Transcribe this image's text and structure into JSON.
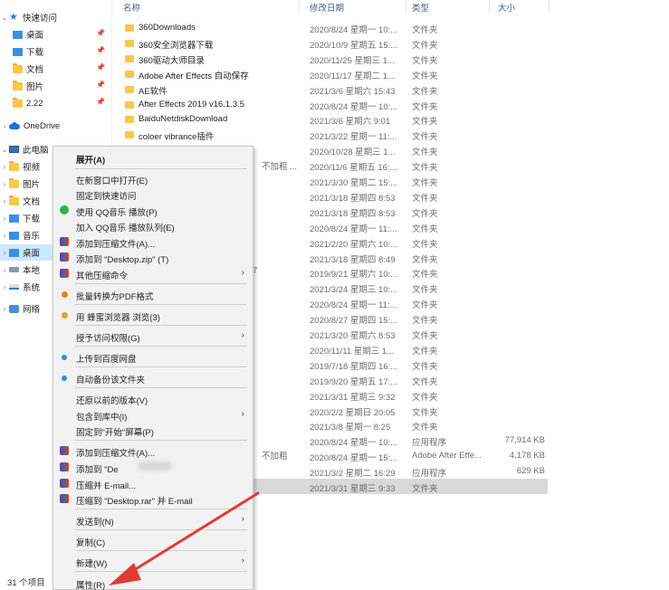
{
  "nav": {
    "quick_access": "快速访问",
    "quick_items": [
      {
        "label": "桌面"
      },
      {
        "label": "下载"
      },
      {
        "label": "文档"
      },
      {
        "label": "图片"
      },
      {
        "label": "2.22"
      }
    ],
    "onedrive": "OneDrive",
    "this_pc": "此电脑",
    "pc_items": [
      {
        "label": "视频"
      },
      {
        "label": "图片"
      },
      {
        "label": "文档"
      },
      {
        "label": "下载"
      },
      {
        "label": "音乐"
      },
      {
        "label": "桌面"
      },
      {
        "label": "本地"
      },
      {
        "label": "系统"
      }
    ],
    "network": "网络",
    "status": "31 个项目"
  },
  "columns": {
    "name": "名称",
    "date": "修改日期",
    "type": "类型",
    "size": "大小"
  },
  "files": [
    {
      "name": "360Downloads",
      "date": "2020/8/24 星期一 10:...",
      "type": "文件夹",
      "size": ""
    },
    {
      "name": "360安全浏览器下载",
      "date": "2020/10/9 星期五 15:...",
      "type": "文件夹",
      "size": ""
    },
    {
      "name": "360驱动大师目录",
      "date": "2020/11/25 星期三 1...",
      "type": "文件夹",
      "size": ""
    },
    {
      "name": "Adobe After Effects 自动保存",
      "date": "2020/11/17 星期二 1...",
      "type": "文件夹",
      "size": ""
    },
    {
      "name": "AE软件",
      "date": "2021/3/6 星期六 15:43",
      "type": "文件夹",
      "size": ""
    },
    {
      "name": "After Effects 2019 v16.1.3.5",
      "date": "2020/8/24 星期一 10:...",
      "type": "文件夹",
      "size": ""
    },
    {
      "name": "BaiduNetdiskDownload",
      "date": "2021/3/6 星期六 9:01",
      "type": "文件夹",
      "size": ""
    },
    {
      "name": "coloer vibrance插件",
      "date": "2021/3/22 星期一 11:...",
      "type": "文件夹",
      "size": ""
    },
    {
      "name": "",
      "date": "2020/10/28 星期三 1...",
      "type": "文件夹",
      "size": ""
    },
    {
      "name": "",
      "date": "2020/11/6 星期五 16:...",
      "type": "文件夹",
      "size": ""
    },
    {
      "name": "",
      "date": "2021/3/30 星期二 15:...",
      "type": "文件夹",
      "size": ""
    },
    {
      "name": "",
      "date": "2021/3/18 星期四 8:53",
      "type": "文件夹",
      "size": ""
    },
    {
      "name": "",
      "date": "2021/3/18 星期四 8:53",
      "type": "文件夹",
      "size": ""
    },
    {
      "name": "",
      "date": "2020/8/24 星期一 11:...",
      "type": "文件夹",
      "size": ""
    },
    {
      "name": "",
      "date": "2021/2/20 星期六 10:...",
      "type": "文件夹",
      "size": ""
    },
    {
      "name": "",
      "date": "2021/3/18 星期四 8:49",
      "type": "文件夹",
      "size": ""
    },
    {
      "name": "",
      "date": "2019/9/21 星期六 10:...",
      "type": "文件夹",
      "size": ""
    },
    {
      "name": "",
      "date": "2021/3/24 星期三 10:...",
      "type": "文件夹",
      "size": ""
    },
    {
      "name": "",
      "date": "2020/8/24 星期一 11:...",
      "type": "文件夹",
      "size": ""
    },
    {
      "name": "",
      "date": "2020/8/27 星期四 15:...",
      "type": "文件夹",
      "size": ""
    },
    {
      "name": "",
      "date": "2021/3/20 星期六 8:53",
      "type": "文件夹",
      "size": ""
    },
    {
      "name": "",
      "date": "2020/11/11 星期三 1...",
      "type": "文件夹",
      "size": ""
    },
    {
      "name": "",
      "date": "2019/7/18 星期四 16:...",
      "type": "文件夹",
      "size": ""
    },
    {
      "name": "",
      "date": "2019/9/20 星期五 17:...",
      "type": "文件夹",
      "size": ""
    },
    {
      "name": "",
      "date": "2021/3/31 星期三 9:32",
      "type": "文件夹",
      "size": ""
    },
    {
      "name": "",
      "date": "2020/2/2 星期日 20:05",
      "type": "文件夹",
      "size": ""
    },
    {
      "name": "",
      "date": "2021/3/8 星期一 8:25",
      "type": "文件夹",
      "size": ""
    },
    {
      "name": "",
      "date": "2020/8/24 星期一 10:...",
      "type": "应用程序",
      "size": "77,914 KB"
    },
    {
      "name": "",
      "date": "2020/8/24 星期一 15:...",
      "type": "Adobe After Effe...",
      "size": "4,178 KB"
    },
    {
      "name": "",
      "date": "2021/3/2 星期二 16:29",
      "type": "应用程序",
      "size": "629 KB"
    },
    {
      "name": "",
      "date": "2021/3/31 星期三 9:33",
      "type": "文件夹",
      "size": ""
    }
  ],
  "peek_texts": {
    "a": "不加粗 ...",
    "b": "7",
    "c": "不加粗"
  },
  "menu": {
    "expand": "展开(A)",
    "open_new": "在新窗口中打开(E)",
    "pin_quick": "固定到快速访问",
    "qq_play": "使用 QQ音乐 播放(P)",
    "qq_queue": "加入 QQ音乐 播放队列(E)",
    "add_archive": "添加到压缩文件(A)...",
    "add_zip": "添加到 \"Desktop.zip\" (T)",
    "other_compress": "其他压缩命令",
    "to_pdf": "批量转换为PDF格式",
    "open_browser": "用 蜂蜜浏览器 浏览(3)",
    "grant_access": "授予访问权限(G)",
    "upload_baidu": "上传到百度网盘",
    "auto_backup": "自动备份该文件夹",
    "restore": "还原以前的版本(V)",
    "include_lib": "包含到库中(I)",
    "pin_start": "固定到\"开始\"屏幕(P)",
    "rar_add": "添加到压缩文件(A)...",
    "rar_add_named": "添加到 \"De",
    "rar_email": "压缩并 E-mail...",
    "rar_email_named": "压缩到 \"Desktop.rar\" 并 E-mail",
    "send_to": "发送到(N)",
    "copy": "复制(C)",
    "new": "新建(W)",
    "properties": "属性(R)"
  },
  "colors": {
    "accent": "#e23b32",
    "selection": "#cce8ff",
    "row_selected": "#d9d9d9"
  }
}
